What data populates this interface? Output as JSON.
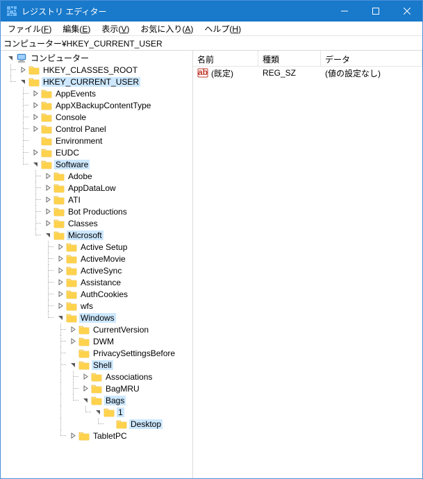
{
  "title": "レジストリ エディター",
  "menus": {
    "file": "ファイル(",
    "file_u": "F",
    "edit": "編集(",
    "edit_u": "E",
    "view": "表示(",
    "view_u": "V",
    "fav": "お気に入り(",
    "fav_u": "A",
    "help": "ヘルプ(",
    "help_u": "H",
    "close": ")"
  },
  "address": "コンピューター¥HKEY_CURRENT_USER",
  "list": {
    "columns": {
      "name": "名前",
      "type": "種類",
      "data": "データ"
    },
    "rows": [
      {
        "name": "(既定)",
        "type": "REG_SZ",
        "data": "(値の設定なし)"
      }
    ]
  },
  "tree": [
    {
      "d": 0,
      "exp": "open",
      "icon": "computer",
      "label": "コンピューター",
      "sel": false
    },
    {
      "d": 1,
      "exp": "closed",
      "icon": "folder",
      "label": "HKEY_CLASSES_ROOT",
      "sel": false
    },
    {
      "d": 1,
      "exp": "open",
      "icon": "folder",
      "label": "HKEY_CURRENT_USER",
      "sel": true
    },
    {
      "d": 2,
      "exp": "closed",
      "icon": "folder",
      "label": "AppEvents",
      "sel": false
    },
    {
      "d": 2,
      "exp": "closed",
      "icon": "folder",
      "label": "AppXBackupContentType",
      "sel": false
    },
    {
      "d": 2,
      "exp": "closed",
      "icon": "folder",
      "label": "Console",
      "sel": false
    },
    {
      "d": 2,
      "exp": "closed",
      "icon": "folder",
      "label": "Control Panel",
      "sel": false
    },
    {
      "d": 2,
      "exp": "none",
      "icon": "folder",
      "label": "Environment",
      "sel": false
    },
    {
      "d": 2,
      "exp": "closed",
      "icon": "folder",
      "label": "EUDC",
      "sel": false
    },
    {
      "d": 2,
      "exp": "open",
      "icon": "folder",
      "label": "Software",
      "sel": true
    },
    {
      "d": 3,
      "exp": "closed",
      "icon": "folder",
      "label": "Adobe",
      "sel": false
    },
    {
      "d": 3,
      "exp": "closed",
      "icon": "folder",
      "label": "AppDataLow",
      "sel": false
    },
    {
      "d": 3,
      "exp": "closed",
      "icon": "folder",
      "label": "ATI",
      "sel": false
    },
    {
      "d": 3,
      "exp": "closed",
      "icon": "folder",
      "label": "Bot Productions",
      "sel": false
    },
    {
      "d": 3,
      "exp": "closed",
      "icon": "folder",
      "label": "Classes",
      "sel": false
    },
    {
      "d": 3,
      "exp": "open",
      "icon": "folder",
      "label": "Microsoft",
      "sel": true
    },
    {
      "d": 4,
      "exp": "closed",
      "icon": "folder",
      "label": "Active Setup",
      "sel": false
    },
    {
      "d": 4,
      "exp": "closed",
      "icon": "folder",
      "label": "ActiveMovie",
      "sel": false
    },
    {
      "d": 4,
      "exp": "closed",
      "icon": "folder",
      "label": "ActiveSync",
      "sel": false
    },
    {
      "d": 4,
      "exp": "closed",
      "icon": "folder",
      "label": "Assistance",
      "sel": false
    },
    {
      "d": 4,
      "exp": "closed",
      "icon": "folder",
      "label": "AuthCookies",
      "sel": false
    },
    {
      "d": 4,
      "exp": "closed",
      "icon": "folder",
      "label": "wfs",
      "sel": false
    },
    {
      "d": 4,
      "exp": "open",
      "icon": "folder",
      "label": "Windows",
      "sel": true
    },
    {
      "d": 5,
      "exp": "closed",
      "icon": "folder",
      "label": "CurrentVersion",
      "sel": false
    },
    {
      "d": 5,
      "exp": "closed",
      "icon": "folder",
      "label": "DWM",
      "sel": false
    },
    {
      "d": 5,
      "exp": "none",
      "icon": "folder",
      "label": "PrivacySettingsBefore",
      "sel": false
    },
    {
      "d": 5,
      "exp": "open",
      "icon": "folder",
      "label": "Shell",
      "sel": true
    },
    {
      "d": 6,
      "exp": "closed",
      "icon": "folder",
      "label": "Associations",
      "sel": false
    },
    {
      "d": 6,
      "exp": "closed",
      "icon": "folder",
      "label": "BagMRU",
      "sel": false
    },
    {
      "d": 6,
      "exp": "open",
      "icon": "folder",
      "label": "Bags",
      "sel": true
    },
    {
      "d": 7,
      "exp": "open",
      "icon": "folder",
      "label": "1",
      "sel": true
    },
    {
      "d": 8,
      "exp": "none",
      "icon": "folder",
      "label": "Desktop",
      "sel": true
    },
    {
      "d": 5,
      "exp": "closed",
      "icon": "folder",
      "label": "TabletPC",
      "sel": false
    }
  ]
}
